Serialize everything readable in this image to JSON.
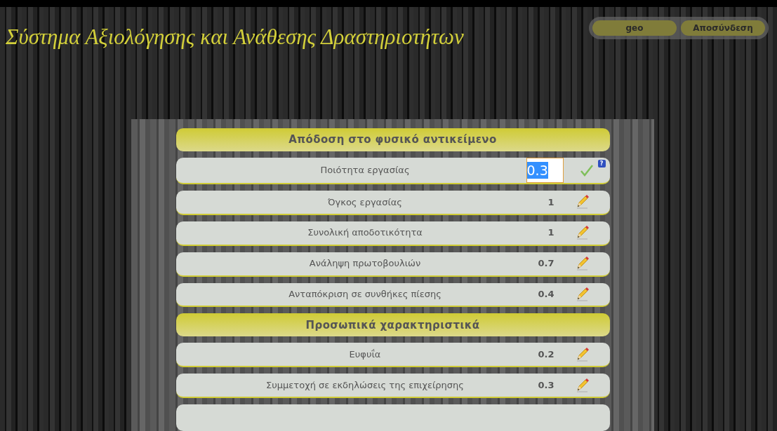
{
  "header": {
    "title": "Σύστημα Αξιολόγησης και Ανάθεσης Δραστηριοτήτων"
  },
  "user_menu": {
    "username": "geo",
    "logout": "Αποσύνδεση"
  },
  "sections": [
    {
      "title": "Απόδοση στο φυσικό αντικείμενο",
      "rows": [
        {
          "kind": "editing",
          "label": "Ποιότητα εργασίας",
          "value": "0.3",
          "help": "?"
        },
        {
          "kind": "view",
          "label": "Όγκος εργασίας",
          "value": "1"
        },
        {
          "kind": "view",
          "label": "Συνολική αποδοτικότητα",
          "value": "1"
        },
        {
          "kind": "view",
          "label": "Ανάληψη πρωτοβουλιών",
          "value": "0.7"
        },
        {
          "kind": "view",
          "label": "Ανταπόκριση σε συνθήκες πίεσης",
          "value": "0.4"
        }
      ]
    },
    {
      "title": "Προσωπικά χαρακτηριστικά",
      "rows": [
        {
          "kind": "view",
          "label": "Ευφυΐα",
          "value": "0.2"
        },
        {
          "kind": "view",
          "label": "Συμμετοχή σε εκδηλώσεις της επιχείρησης",
          "value": "0.3"
        }
      ]
    }
  ]
}
